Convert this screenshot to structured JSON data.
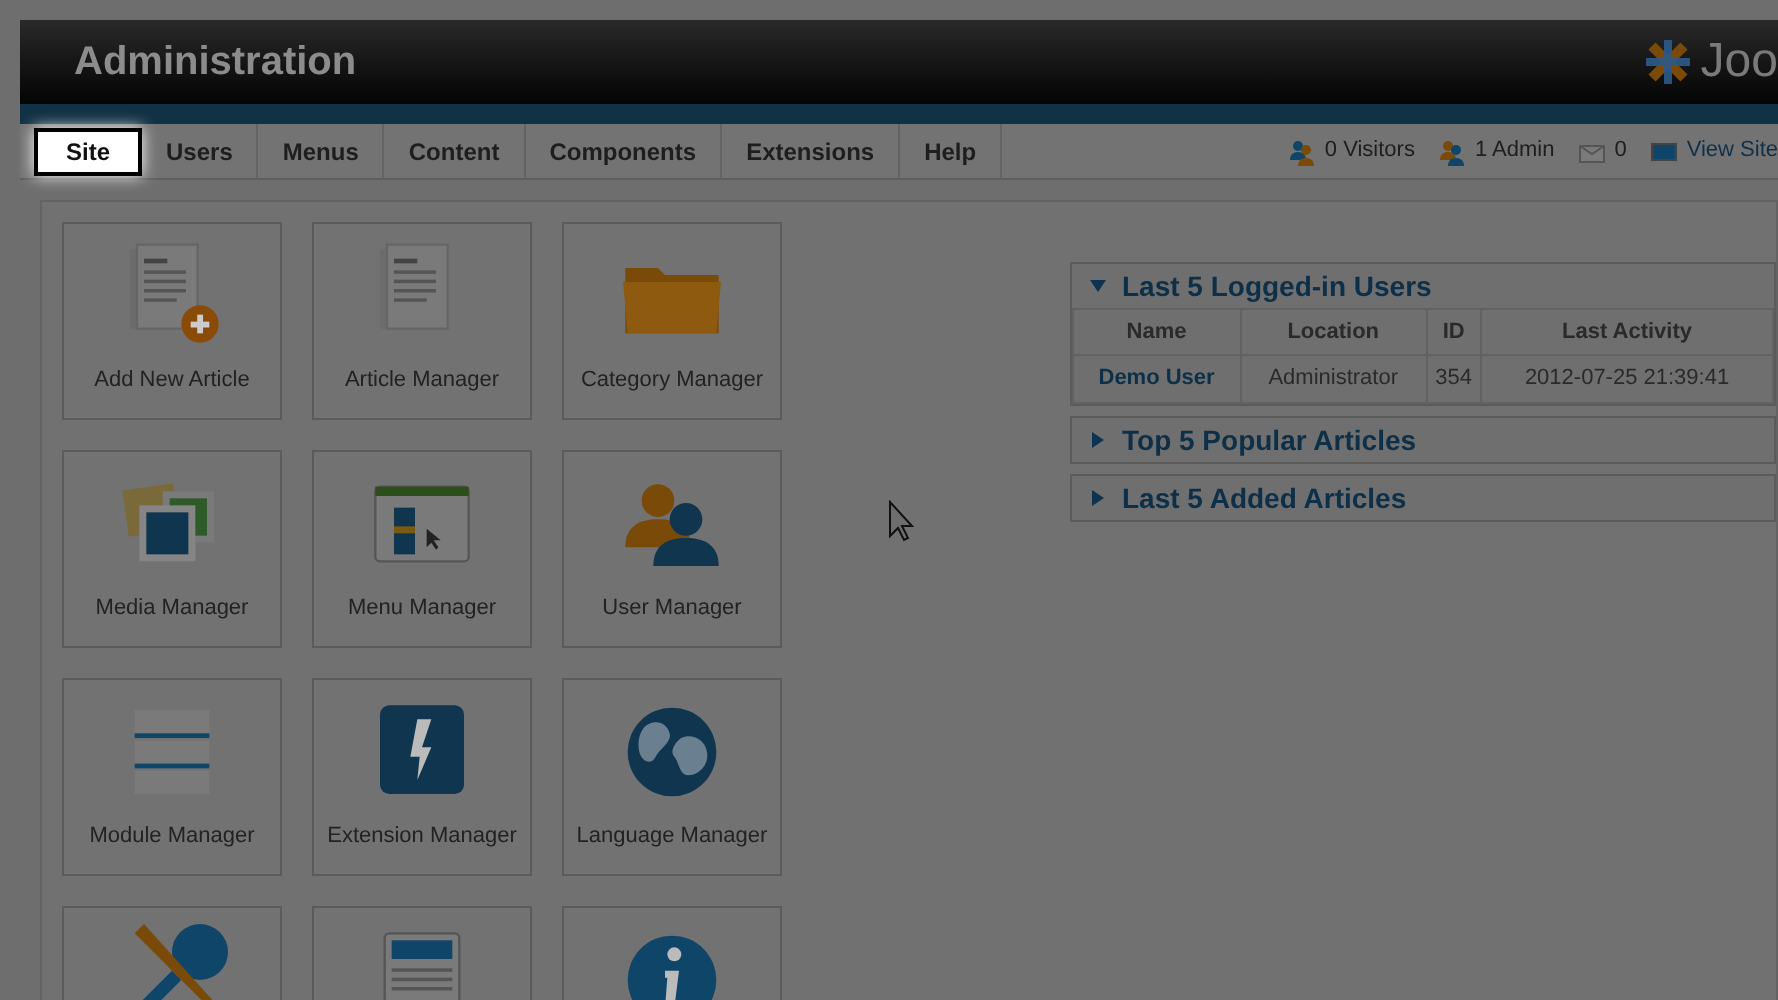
{
  "header": {
    "title": "Administration",
    "logo_text": "Joo"
  },
  "menu": [
    {
      "label": "Site",
      "selected": true
    },
    {
      "label": "Users",
      "selected": false
    },
    {
      "label": "Menus",
      "selected": false
    },
    {
      "label": "Content",
      "selected": false
    },
    {
      "label": "Components",
      "selected": false
    },
    {
      "label": "Extensions",
      "selected": false
    },
    {
      "label": "Help",
      "selected": false
    }
  ],
  "status": [
    {
      "kind": "visitors",
      "label": "0 Visitors"
    },
    {
      "kind": "admins",
      "label": "1 Admin"
    },
    {
      "kind": "messages",
      "label": "0"
    },
    {
      "kind": "site",
      "label": "View Site"
    }
  ],
  "quick_icons": [
    {
      "kind": "add-article",
      "label": "Add New Article"
    },
    {
      "kind": "articles",
      "label": "Article Manager"
    },
    {
      "kind": "category",
      "label": "Category Manager"
    },
    {
      "kind": "media",
      "label": "Media Manager"
    },
    {
      "kind": "menu",
      "label": "Menu Manager"
    },
    {
      "kind": "users",
      "label": "User Manager"
    },
    {
      "kind": "module",
      "label": "Module Manager"
    },
    {
      "kind": "extension",
      "label": "Extension Manager"
    },
    {
      "kind": "language",
      "label": "Language Manager"
    },
    {
      "kind": "tools"
    },
    {
      "kind": "template"
    },
    {
      "kind": "info"
    }
  ],
  "panels": [
    {
      "title": "Last 5 Logged-in Users",
      "expanded": true,
      "table": {
        "columns": [
          "Name",
          "Location",
          "ID",
          "Last Activity"
        ],
        "rows": [
          [
            "Demo User",
            "Administrator",
            "354",
            "2012-07-25 21:39:41"
          ]
        ]
      }
    },
    {
      "title": "Top 5 Popular Articles",
      "expanded": false
    },
    {
      "title": "Last 5 Added Articles",
      "expanded": false
    }
  ]
}
